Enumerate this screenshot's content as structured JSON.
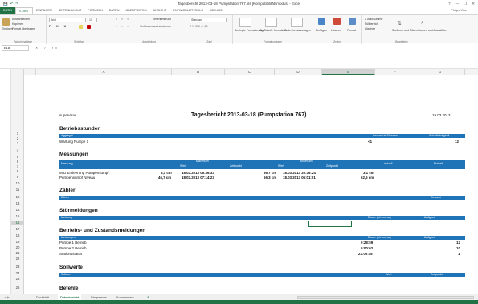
{
  "window": {
    "title": "Tagesbericht 2013-03-18 Pumpstation 767.xls [Kompatibilitätsmodus] - Excel",
    "quick_access": [
      "💾",
      "↶",
      "↷"
    ],
    "controls": [
      "?",
      "—",
      "❐",
      "✕"
    ]
  },
  "ribbon": {
    "tabs": [
      "DATEI",
      "START",
      "EINFÜGEN",
      "SEITENLAYOUT",
      "FORMELN",
      "DATEN",
      "ÜBERPRÜFEN",
      "ANSICHT",
      "ENTWICKLERTOOLS",
      "ADD-INS"
    ],
    "active_tab": "START",
    "signin": "Pfriger Vine",
    "clipboard": {
      "cut": "Ausschneiden",
      "copy": "Kopieren",
      "format_painter": "Format übertragen",
      "paste": "Einfügen",
      "label": "Zwischenablage"
    },
    "font": {
      "name": "Arial",
      "size": "10",
      "label": "Schriftart"
    },
    "alignment": {
      "wrap": "Zeilenumbruch",
      "merge": "Verbinden und zentrieren",
      "label": "Ausrichtung"
    },
    "number": {
      "format": "Standard",
      "label": "Zahl"
    },
    "styles": {
      "conditional": "Bedingte Formatierung",
      "as_table": "Als Tabelle formatieren",
      "cell_styles": "Zellenformatvorlagen",
      "label": "Formatvorlagen"
    },
    "cells": {
      "insert": "Einfügen",
      "delete": "Löschen",
      "format": "Format",
      "label": "Zellen"
    },
    "editing": {
      "autosum": "AutoSumme",
      "fill": "Füllbereich",
      "clear": "Löschen",
      "sort": "Sortieren und Filtern",
      "find": "Suchen und Auswählen",
      "label": "Bearbeiten"
    }
  },
  "formula_bar": {
    "name_box": "E18",
    "value": ""
  },
  "columns": [
    "A",
    "B",
    "C",
    "D",
    "E",
    "F",
    "G"
  ],
  "selected_column": "E",
  "rows": [
    "1",
    "2",
    "3",
    "4",
    "5",
    "6",
    "7",
    "8",
    "9",
    "10",
    "11",
    "12",
    "13",
    "14",
    "15",
    "16",
    "17",
    "18",
    "19",
    "20",
    "21",
    "22",
    "23",
    "24",
    "25",
    "26"
  ],
  "selected_row": "16",
  "report": {
    "user": "supervisor",
    "title": "Tagesbericht 2013-03-18 (Pumpstation 767)",
    "date": "19.03.2013",
    "sections": {
      "betriebsstunden": {
        "heading": "Betriebsstunden",
        "headers": [
          "Aggregat",
          "Laufzeit in Stunden",
          "Schalthäufigkeit"
        ],
        "row": {
          "name": "Wartung Pumpe 1",
          "hours": "<1",
          "count": "12"
        }
      },
      "messungen": {
        "heading": "Messungen",
        "headers": {
          "messung": "Messung",
          "maximum": "Maximum",
          "minimum": "Minimum",
          "wert": "Wert",
          "zeitpunkt": "Zeitpunkt",
          "aktuell": "aktuell",
          "einheit": "Einheit"
        },
        "rows": [
          {
            "name": "MID Entleerung Pumpensumpf",
            "max": "5,1 cm",
            "max_time": "18.03.2013 06:36:33",
            "min": "56,7 cm",
            "min_time": "18.03.2013 20:36:24",
            "current": "3,1 cm"
          },
          {
            "name": "Pumpensumpf Niveau",
            "max": "46,7 cm",
            "max_time": "18.03.2013 07:14:23",
            "min": "66,3 cm",
            "min_time": "18.03.2013 06:01:01",
            "current": "62,6 cm"
          }
        ]
      },
      "zaehler": {
        "heading": "Zähler",
        "headers": [
          "Zähler",
          "Gesamt"
        ]
      },
      "stoerungen": {
        "heading": "Störmeldungen",
        "headers": [
          "Meldung",
          "Dauer (hh:mm:ss)",
          "Häufigkeit"
        ]
      },
      "zustand": {
        "heading": "Betriebs- und Zustandsmeldungen",
        "headers": [
          "Meldungen",
          "Dauer (hh:mm:ss)",
          "Häufigkeit"
        ],
        "rows": [
          {
            "name": "Pumpe 1 Betrieb",
            "duration": "0:28:59",
            "count": "12"
          },
          {
            "name": "Pumpe 2 Betrieb",
            "duration": "0:00:02",
            "count": "10"
          },
          {
            "name": "Stationsstatus",
            "duration": "23:00:45",
            "count": "1"
          }
        ]
      },
      "sollwerte": {
        "heading": "Sollwerte",
        "headers": [
          "Sollwert",
          "Wert",
          "Zeitpunkt"
        ]
      },
      "befehle": {
        "heading": "Befehle"
      }
    }
  },
  "sheet_tabs": [
    "Deckblatt",
    "Datenbericht",
    "Diagramme",
    "Kommentare"
  ],
  "active_sheet": "Datenbericht",
  "add_sheet": "⊕",
  "colors": {
    "excel_green": "#217346",
    "header_blue": "#1f73b7"
  }
}
